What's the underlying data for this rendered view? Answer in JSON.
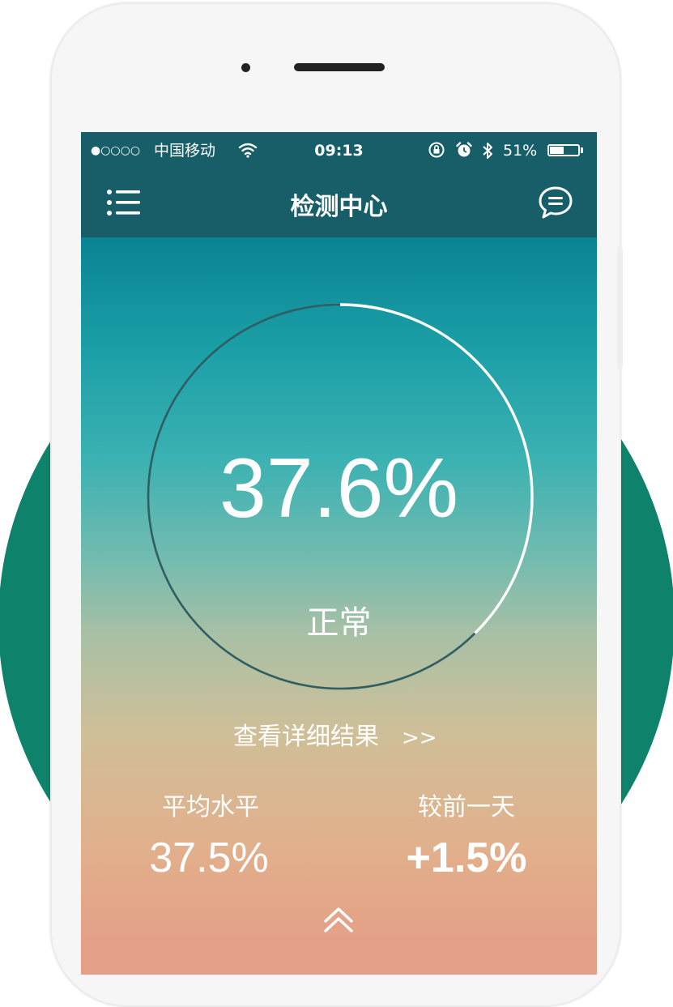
{
  "status_bar": {
    "signal": "●○○○○",
    "carrier": "中国移动",
    "wifi": "wifi-icon",
    "time": "09:13",
    "lock": "rotation-lock-icon",
    "alarm": "alarm-icon",
    "bluetooth": "bluetooth-icon",
    "battery_percent": "51%",
    "battery_level": 0.51
  },
  "nav": {
    "title": "检测中心",
    "menu_icon": "list-menu-icon",
    "chat_icon": "chat-bubble-icon"
  },
  "gauge": {
    "value_text": "37.6%",
    "progress": 0.376,
    "status": "正常"
  },
  "details": {
    "label": "查看详细结果",
    "arrows": ">>"
  },
  "stats": {
    "average_label": "平均水平",
    "average_value": "37.5%",
    "compare_label": "较前一天",
    "compare_value": "+1.5%"
  },
  "footer": {
    "expand_icon": "double-chevron-up-icon"
  },
  "colors": {
    "brand_green": "#0e826a",
    "header_teal": "#175e69",
    "gradient_top": "#0a8393",
    "gradient_bottom": "#e4a087"
  }
}
